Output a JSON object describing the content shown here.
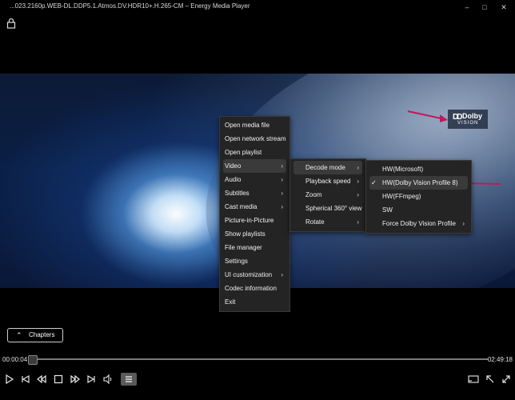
{
  "window": {
    "title": "...023.2160p.WEB-DL.DDP5.1.Atmos.DV.HDR10+.H.265-CM – Energy Media Player",
    "controls": [
      "minimize-icon",
      "maximize-icon",
      "close-icon"
    ]
  },
  "overlay": {
    "logo_brand": "Dolby",
    "logo_sub": "VISION",
    "accent_arrow_color": "#c2185b"
  },
  "context_menu": {
    "main": [
      {
        "label": "Open media file",
        "submenu": false
      },
      {
        "label": "Open network stream",
        "submenu": false
      },
      {
        "label": "Open playlist",
        "submenu": false
      },
      {
        "label": "Video",
        "submenu": true,
        "active": true
      },
      {
        "label": "Audio",
        "submenu": true
      },
      {
        "label": "Subtitles",
        "submenu": true
      },
      {
        "label": "Cast media",
        "submenu": true
      },
      {
        "label": "Picture-in-Picture",
        "submenu": false
      },
      {
        "label": "Show playlists",
        "submenu": false
      },
      {
        "label": "File manager",
        "submenu": false
      },
      {
        "label": "Settings",
        "submenu": false
      },
      {
        "label": "UI customization",
        "submenu": true
      },
      {
        "label": "Codec information",
        "submenu": false
      },
      {
        "label": "Exit",
        "submenu": false
      }
    ],
    "video_submenu": [
      {
        "label": "Decode mode",
        "submenu": true,
        "active": true
      },
      {
        "label": "Playback speed",
        "submenu": true
      },
      {
        "label": "Zoom",
        "submenu": true
      },
      {
        "label": "Spherical 360° view",
        "submenu": false
      },
      {
        "label": "Rotate",
        "submenu": true
      }
    ],
    "decode_submenu": [
      {
        "label": "HW(Microsoft)",
        "checked": false
      },
      {
        "label": "HW(Dolby Vision Profile 8)",
        "checked": true
      },
      {
        "label": "HW(FFmpeg)",
        "checked": false
      },
      {
        "label": "SW",
        "checked": false
      },
      {
        "label": "Force Dolby Vision Profile",
        "submenu": true
      }
    ]
  },
  "player": {
    "chapters_label": "Chapters",
    "time_current": "00:00:04",
    "time_total": "02:49:18",
    "progress_fraction": 0.0004,
    "accent_color": "#4aa3ff"
  },
  "icons": {
    "lock": "lock-icon",
    "play": "play-icon",
    "skip_back": "skip-previous-icon",
    "rewind": "rewind-icon",
    "stop": "stop-icon",
    "forward": "fast-forward-icon",
    "skip_next": "skip-next-icon",
    "volume": "volume-icon",
    "playlist": "playlist-icon",
    "cast": "cast-icon",
    "pip": "collapse-icon",
    "fullscreen": "fullscreen-icon"
  }
}
